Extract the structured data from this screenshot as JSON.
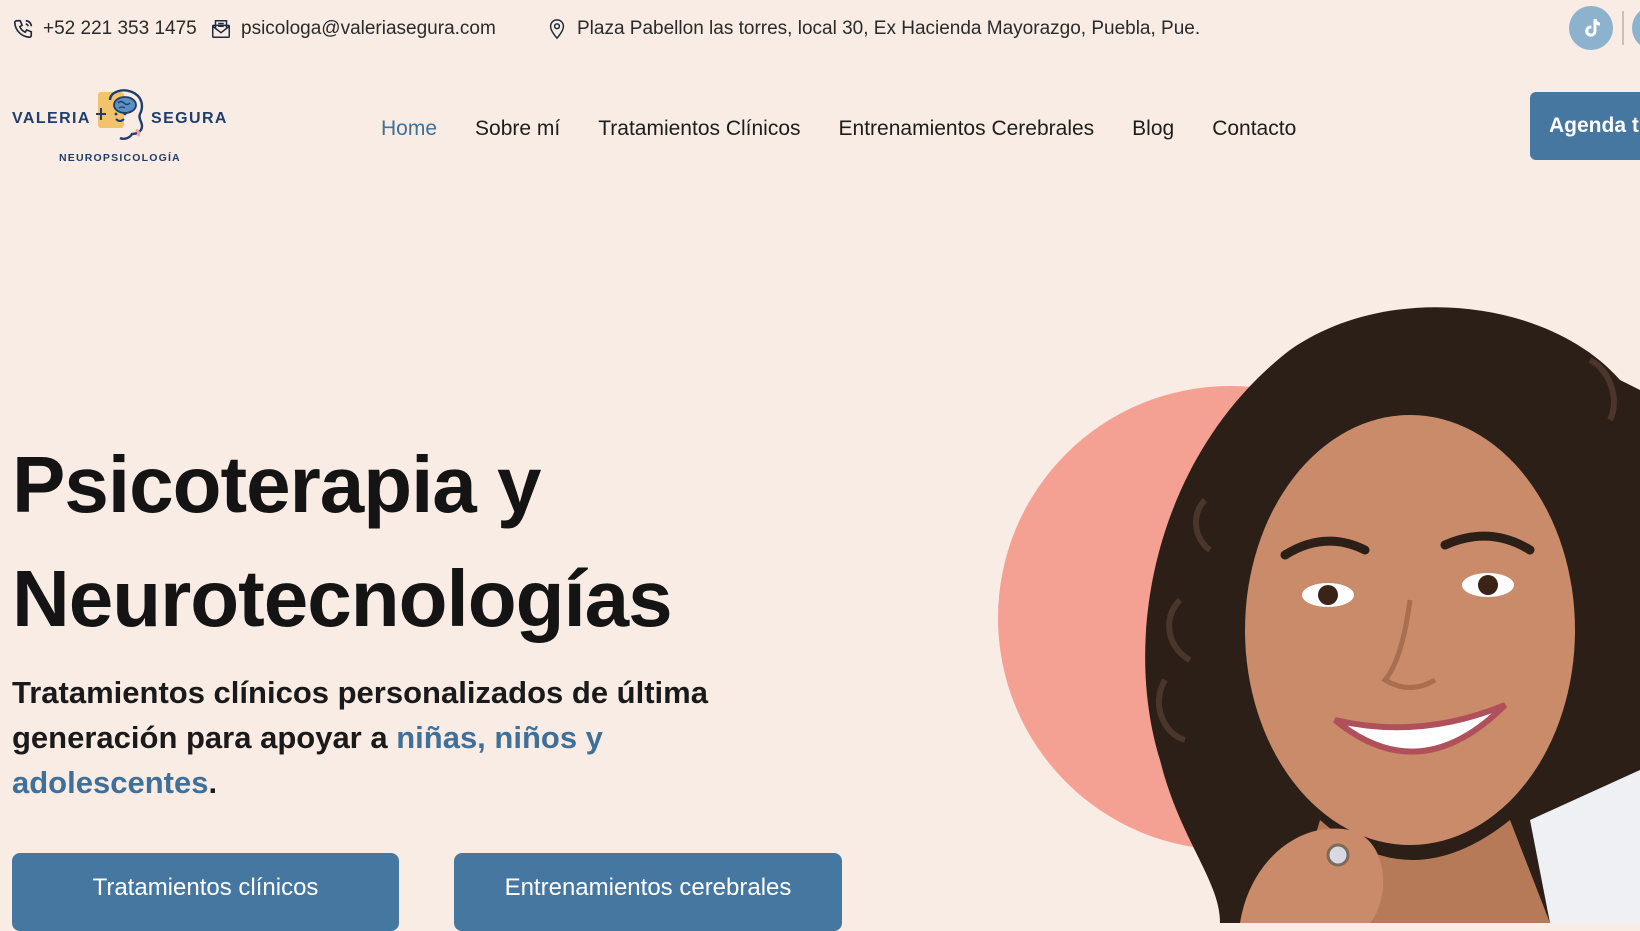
{
  "topbar": {
    "phone": "+52 221 353 1475",
    "email": "psicologa@valeriasegura.com",
    "address": "Plaza Pabellon las torres, local 30, Ex Hacienda Mayorazgo, Puebla, Pue."
  },
  "logo": {
    "word1": "VALERIA",
    "word2": "SEGURA",
    "subtitle": "NEUROPSICOLOGÍA"
  },
  "nav": {
    "items": [
      {
        "label": "Home"
      },
      {
        "label": "Sobre mí"
      },
      {
        "label": "Tratamientos Clínicos"
      },
      {
        "label": "Entrenamientos Cerebrales"
      },
      {
        "label": "Blog"
      },
      {
        "label": "Contacto"
      }
    ],
    "cta": "Agenda t"
  },
  "hero": {
    "title_line1": "Psicoterapia y",
    "title_line2": "Neurotecnologías",
    "sub_part1": "Tratamientos clínicos personalizados de última generación para apoyar a ",
    "sub_highlight": "niñas, niños y adolescentes",
    "sub_end": ".",
    "button1": "Tratamientos clínicos",
    "button2": "Entrenamientos cerebrales"
  },
  "colors": {
    "background": "#f9ece4",
    "accent": "#4677a0",
    "highlight_text": "#3f7099",
    "circle": "#f4a093",
    "social": "#8db2cd"
  },
  "icons": [
    "phone-icon",
    "mail-icon",
    "location-pin-icon",
    "tiktok-icon"
  ]
}
